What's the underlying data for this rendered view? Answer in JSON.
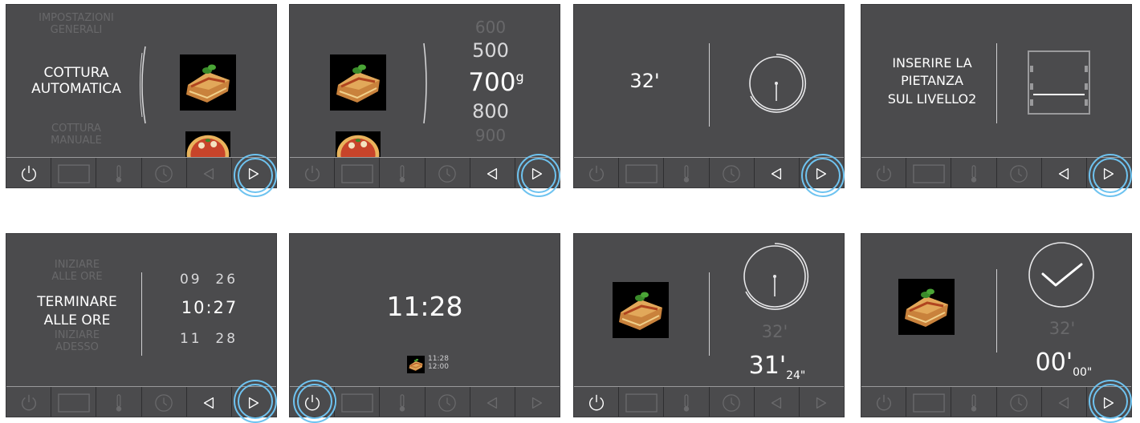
{
  "panels": {
    "p1": {
      "menu": [
        "IMPOSTAZIONI",
        "GENERALI",
        "COTTURA",
        "AUTOMATICA",
        "COTTURA",
        "MANUALE"
      ]
    },
    "p2": {
      "weights": [
        "600",
        "500",
        "700",
        "g",
        "800",
        "900"
      ]
    },
    "p3": {
      "time": "32'"
    },
    "p4": {
      "message": [
        "INSERIRE LA",
        "PIETANZA",
        "SUL LIVELLO2"
      ]
    },
    "p5": {
      "options": [
        "INIZIARE",
        "ALLE ORE",
        "TERMINARE",
        "ALLE ORE",
        "INIZIARE",
        "ADESSO"
      ],
      "times": [
        "09",
        "26",
        "10",
        ":",
        "27",
        "11",
        "28"
      ]
    },
    "p6": {
      "clock": "11:28",
      "mini_times": [
        "11:28",
        "12:00"
      ]
    },
    "p7": {
      "set_time": "32'",
      "remaining_min": "31'",
      "remaining_sec": "24\""
    },
    "p8": {
      "set_time": "32'",
      "remaining_min": "00'",
      "remaining_sec": "00\""
    }
  },
  "toolbar_icons": [
    "power-icon",
    "oven-display-icon",
    "thermometer-icon",
    "clock-icon",
    "arrow-left-icon",
    "arrow-right-icon"
  ],
  "colors": {
    "panel_bg": "#4b4b4d",
    "text": "#ffffff",
    "dim_text": "#7a7a7c",
    "highlight_ring": "#6ec3f0",
    "inactive_icon": "#6a6a6c"
  }
}
